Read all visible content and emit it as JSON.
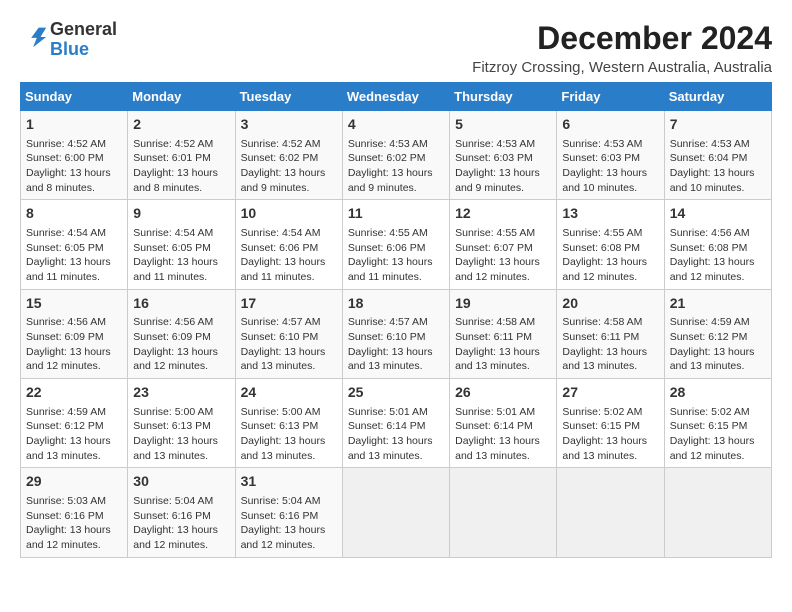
{
  "logo": {
    "line1": "General",
    "line2": "Blue"
  },
  "title": "December 2024",
  "subtitle": "Fitzroy Crossing, Western Australia, Australia",
  "weekdays": [
    "Sunday",
    "Monday",
    "Tuesday",
    "Wednesday",
    "Thursday",
    "Friday",
    "Saturday"
  ],
  "weeks": [
    [
      {
        "day": 1,
        "info": "Sunrise: 4:52 AM\nSunset: 6:00 PM\nDaylight: 13 hours\nand 8 minutes."
      },
      {
        "day": 2,
        "info": "Sunrise: 4:52 AM\nSunset: 6:01 PM\nDaylight: 13 hours\nand 8 minutes."
      },
      {
        "day": 3,
        "info": "Sunrise: 4:52 AM\nSunset: 6:02 PM\nDaylight: 13 hours\nand 9 minutes."
      },
      {
        "day": 4,
        "info": "Sunrise: 4:53 AM\nSunset: 6:02 PM\nDaylight: 13 hours\nand 9 minutes."
      },
      {
        "day": 5,
        "info": "Sunrise: 4:53 AM\nSunset: 6:03 PM\nDaylight: 13 hours\nand 9 minutes."
      },
      {
        "day": 6,
        "info": "Sunrise: 4:53 AM\nSunset: 6:03 PM\nDaylight: 13 hours\nand 10 minutes."
      },
      {
        "day": 7,
        "info": "Sunrise: 4:53 AM\nSunset: 6:04 PM\nDaylight: 13 hours\nand 10 minutes."
      }
    ],
    [
      {
        "day": 8,
        "info": "Sunrise: 4:54 AM\nSunset: 6:05 PM\nDaylight: 13 hours\nand 11 minutes."
      },
      {
        "day": 9,
        "info": "Sunrise: 4:54 AM\nSunset: 6:05 PM\nDaylight: 13 hours\nand 11 minutes."
      },
      {
        "day": 10,
        "info": "Sunrise: 4:54 AM\nSunset: 6:06 PM\nDaylight: 13 hours\nand 11 minutes."
      },
      {
        "day": 11,
        "info": "Sunrise: 4:55 AM\nSunset: 6:06 PM\nDaylight: 13 hours\nand 11 minutes."
      },
      {
        "day": 12,
        "info": "Sunrise: 4:55 AM\nSunset: 6:07 PM\nDaylight: 13 hours\nand 12 minutes."
      },
      {
        "day": 13,
        "info": "Sunrise: 4:55 AM\nSunset: 6:08 PM\nDaylight: 13 hours\nand 12 minutes."
      },
      {
        "day": 14,
        "info": "Sunrise: 4:56 AM\nSunset: 6:08 PM\nDaylight: 13 hours\nand 12 minutes."
      }
    ],
    [
      {
        "day": 15,
        "info": "Sunrise: 4:56 AM\nSunset: 6:09 PM\nDaylight: 13 hours\nand 12 minutes."
      },
      {
        "day": 16,
        "info": "Sunrise: 4:56 AM\nSunset: 6:09 PM\nDaylight: 13 hours\nand 12 minutes."
      },
      {
        "day": 17,
        "info": "Sunrise: 4:57 AM\nSunset: 6:10 PM\nDaylight: 13 hours\nand 13 minutes."
      },
      {
        "day": 18,
        "info": "Sunrise: 4:57 AM\nSunset: 6:10 PM\nDaylight: 13 hours\nand 13 minutes."
      },
      {
        "day": 19,
        "info": "Sunrise: 4:58 AM\nSunset: 6:11 PM\nDaylight: 13 hours\nand 13 minutes."
      },
      {
        "day": 20,
        "info": "Sunrise: 4:58 AM\nSunset: 6:11 PM\nDaylight: 13 hours\nand 13 minutes."
      },
      {
        "day": 21,
        "info": "Sunrise: 4:59 AM\nSunset: 6:12 PM\nDaylight: 13 hours\nand 13 minutes."
      }
    ],
    [
      {
        "day": 22,
        "info": "Sunrise: 4:59 AM\nSunset: 6:12 PM\nDaylight: 13 hours\nand 13 minutes."
      },
      {
        "day": 23,
        "info": "Sunrise: 5:00 AM\nSunset: 6:13 PM\nDaylight: 13 hours\nand 13 minutes."
      },
      {
        "day": 24,
        "info": "Sunrise: 5:00 AM\nSunset: 6:13 PM\nDaylight: 13 hours\nand 13 minutes."
      },
      {
        "day": 25,
        "info": "Sunrise: 5:01 AM\nSunset: 6:14 PM\nDaylight: 13 hours\nand 13 minutes."
      },
      {
        "day": 26,
        "info": "Sunrise: 5:01 AM\nSunset: 6:14 PM\nDaylight: 13 hours\nand 13 minutes."
      },
      {
        "day": 27,
        "info": "Sunrise: 5:02 AM\nSunset: 6:15 PM\nDaylight: 13 hours\nand 13 minutes."
      },
      {
        "day": 28,
        "info": "Sunrise: 5:02 AM\nSunset: 6:15 PM\nDaylight: 13 hours\nand 12 minutes."
      }
    ],
    [
      {
        "day": 29,
        "info": "Sunrise: 5:03 AM\nSunset: 6:16 PM\nDaylight: 13 hours\nand 12 minutes."
      },
      {
        "day": 30,
        "info": "Sunrise: 5:04 AM\nSunset: 6:16 PM\nDaylight: 13 hours\nand 12 minutes."
      },
      {
        "day": 31,
        "info": "Sunrise: 5:04 AM\nSunset: 6:16 PM\nDaylight: 13 hours\nand 12 minutes."
      },
      null,
      null,
      null,
      null
    ]
  ]
}
